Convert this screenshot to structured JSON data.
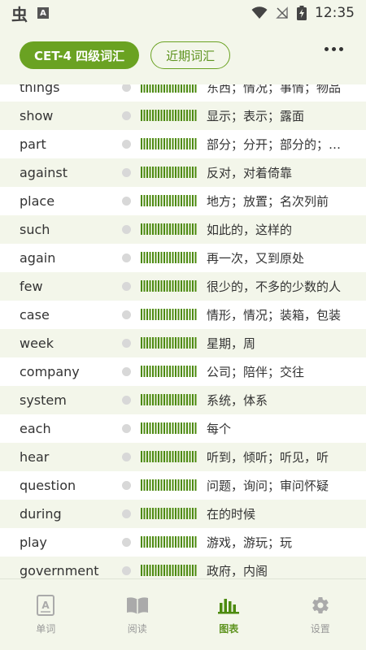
{
  "status_bar": {
    "app_glyph": "虫",
    "a_glyph": "A",
    "time": "12:35"
  },
  "header": {
    "tabs": [
      {
        "label": "CET-4 四级词汇",
        "active": true
      },
      {
        "label": "近期词汇",
        "active": false
      }
    ]
  },
  "words": [
    {
      "word": "things",
      "meaning": "东西；情况；事情；物品"
    },
    {
      "word": "show",
      "meaning": "显示；表示；露面"
    },
    {
      "word": "part",
      "meaning": "部分；分开；部分的；部分地"
    },
    {
      "word": "against",
      "meaning": "反对，对着倚靠"
    },
    {
      "word": "place",
      "meaning": "地方；放置；名次列前"
    },
    {
      "word": "such",
      "meaning": "如此的，这样的"
    },
    {
      "word": "again",
      "meaning": "再一次，又到原处"
    },
    {
      "word": "few",
      "meaning": "很少的，不多的少数的人"
    },
    {
      "word": "case",
      "meaning": "情形，情况；装箱，包装"
    },
    {
      "word": "week",
      "meaning": "星期，周"
    },
    {
      "word": "company",
      "meaning": "公司；陪伴；交往"
    },
    {
      "word": "system",
      "meaning": "系统，体系"
    },
    {
      "word": "each",
      "meaning": "每个"
    },
    {
      "word": "hear",
      "meaning": "听到，倾听；听见，听"
    },
    {
      "word": "question",
      "meaning": "问题，询问；审问怀疑"
    },
    {
      "word": "during",
      "meaning": "在的时候"
    },
    {
      "word": "play",
      "meaning": "游戏，游玩；玩"
    },
    {
      "word": "government",
      "meaning": "政府，内阁"
    }
  ],
  "nav": [
    {
      "label": "单词",
      "icon": "word-book-icon",
      "active": false
    },
    {
      "label": "阅读",
      "icon": "open-book-icon",
      "active": false
    },
    {
      "label": "图表",
      "icon": "bar-chart-icon",
      "active": true
    },
    {
      "label": "设置",
      "icon": "gear-icon",
      "active": false
    }
  ],
  "colors": {
    "accent": "#6aa222",
    "bar": "#4c8a0f",
    "background": "#f3f6ea"
  }
}
